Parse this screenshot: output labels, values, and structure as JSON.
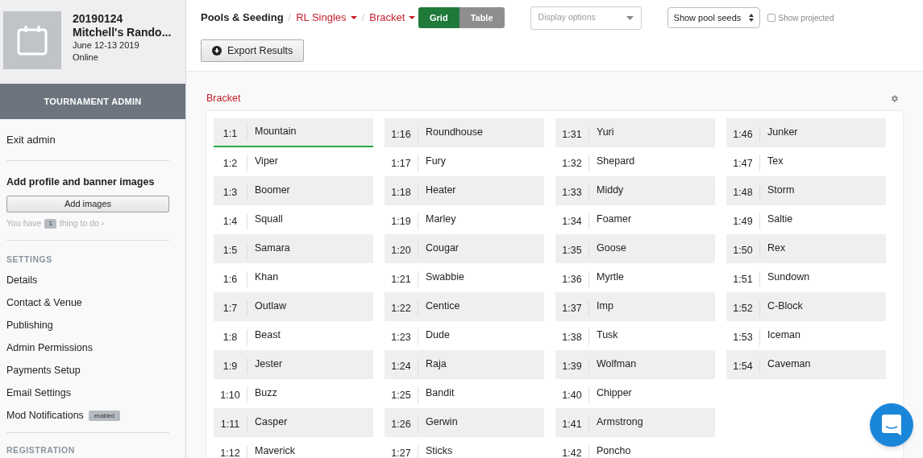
{
  "event": {
    "date_code": "20190124",
    "name": "Mitchell's Rando...",
    "dates": "June 12-13 2019",
    "location": "Online"
  },
  "admin_bar": "TOURNAMENT ADMIN",
  "sidebar": {
    "exit": "Exit admin",
    "task_title": "Add profile and banner images",
    "task_button": "Add images",
    "todo_prefix": "You have",
    "todo_count": "1",
    "todo_suffix": "thing to do ›",
    "sections": [
      {
        "heading": "SETTINGS",
        "items": [
          {
            "label": "Details"
          },
          {
            "label": "Contact & Venue"
          },
          {
            "label": "Publishing"
          },
          {
            "label": "Admin Permissions"
          },
          {
            "label": "Payments Setup"
          },
          {
            "label": "Email Settings"
          },
          {
            "label": "Mod Notifications",
            "badge": "enabled"
          }
        ]
      },
      {
        "heading": "REGISTRATION"
      }
    ]
  },
  "breadcrumb_separator": "/",
  "breadcrumb": [
    {
      "label": "Pools & Seeding",
      "dropdown": false
    },
    {
      "label": "RL Singles",
      "dropdown": true
    },
    {
      "label": "Bracket",
      "dropdown": true
    }
  ],
  "view_toggle": [
    {
      "label": "Grid",
      "selected": true
    },
    {
      "label": "Table",
      "selected": false
    }
  ],
  "display_options": {
    "placeholder": "Display options"
  },
  "seed_select": {
    "value": "Show pool seeds"
  },
  "show_projected": {
    "label": "Show projected",
    "checked": false
  },
  "export_button": "Export Results",
  "section_title": "Bracket",
  "columns": [
    [
      {
        "seed": "1:1",
        "name": "Mountain",
        "selected": true
      },
      {
        "seed": "1:2",
        "name": "Viper",
        "selected": false
      },
      {
        "seed": "1:3",
        "name": "Boomer",
        "selected": false
      },
      {
        "seed": "1:4",
        "name": "Squall",
        "selected": false
      },
      {
        "seed": "1:5",
        "name": "Samara",
        "selected": false
      },
      {
        "seed": "1:6",
        "name": "Khan",
        "selected": false
      },
      {
        "seed": "1:7",
        "name": "Outlaw",
        "selected": false
      },
      {
        "seed": "1:8",
        "name": "Beast",
        "selected": false
      },
      {
        "seed": "1:9",
        "name": "Jester",
        "selected": false
      },
      {
        "seed": "1:10",
        "name": "Buzz",
        "selected": false
      },
      {
        "seed": "1:11",
        "name": "Casper",
        "selected": false
      },
      {
        "seed": "1:12",
        "name": "Maverick",
        "selected": false
      }
    ],
    [
      {
        "seed": "1:16",
        "name": "Roundhouse",
        "selected": false
      },
      {
        "seed": "1:17",
        "name": "Fury",
        "selected": false
      },
      {
        "seed": "1:18",
        "name": "Heater",
        "selected": false
      },
      {
        "seed": "1:19",
        "name": "Marley",
        "selected": false
      },
      {
        "seed": "1:20",
        "name": "Cougar",
        "selected": false
      },
      {
        "seed": "1:21",
        "name": "Swabbie",
        "selected": false
      },
      {
        "seed": "1:22",
        "name": "Centice",
        "selected": false
      },
      {
        "seed": "1:23",
        "name": "Dude",
        "selected": false
      },
      {
        "seed": "1:24",
        "name": "Raja",
        "selected": false
      },
      {
        "seed": "1:25",
        "name": "Bandit",
        "selected": false
      },
      {
        "seed": "1:26",
        "name": "Gerwin",
        "selected": false
      },
      {
        "seed": "1:27",
        "name": "Sticks",
        "selected": false
      }
    ],
    [
      {
        "seed": "1:31",
        "name": "Yuri",
        "selected": false
      },
      {
        "seed": "1:32",
        "name": "Shepard",
        "selected": false
      },
      {
        "seed": "1:33",
        "name": "Middy",
        "selected": false
      },
      {
        "seed": "1:34",
        "name": "Foamer",
        "selected": false
      },
      {
        "seed": "1:35",
        "name": "Goose",
        "selected": false
      },
      {
        "seed": "1:36",
        "name": "Myrtle",
        "selected": false
      },
      {
        "seed": "1:37",
        "name": "Imp",
        "selected": false
      },
      {
        "seed": "1:38",
        "name": "Tusk",
        "selected": false
      },
      {
        "seed": "1:39",
        "name": "Wolfman",
        "selected": false
      },
      {
        "seed": "1:40",
        "name": "Chipper",
        "selected": false
      },
      {
        "seed": "1:41",
        "name": "Armstrong",
        "selected": false
      },
      {
        "seed": "1:42",
        "name": "Poncho",
        "selected": false
      }
    ],
    [
      {
        "seed": "1:46",
        "name": "Junker",
        "selected": false
      },
      {
        "seed": "1:47",
        "name": "Tex",
        "selected": false
      },
      {
        "seed": "1:48",
        "name": "Storm",
        "selected": false
      },
      {
        "seed": "1:49",
        "name": "Saltie",
        "selected": false
      },
      {
        "seed": "1:50",
        "name": "Rex",
        "selected": false
      },
      {
        "seed": "1:51",
        "name": "Sundown",
        "selected": false
      },
      {
        "seed": "1:52",
        "name": "C-Block",
        "selected": false
      },
      {
        "seed": "1:53",
        "name": "Iceman",
        "selected": false
      },
      {
        "seed": "1:54",
        "name": "Caveman",
        "selected": false
      }
    ]
  ]
}
